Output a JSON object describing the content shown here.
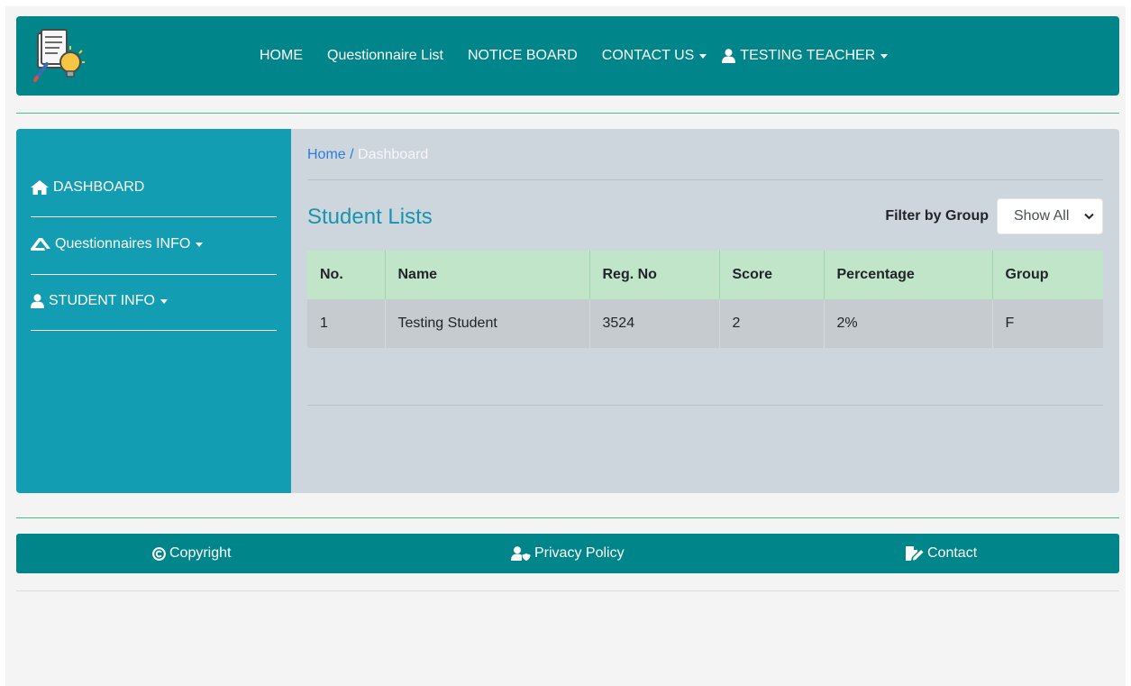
{
  "header": {
    "nav": [
      {
        "label": "HOME"
      },
      {
        "label": "Questionnaire List"
      },
      {
        "label": "NOTICE BOARD"
      },
      {
        "label": "CONTACT US"
      },
      {
        "label": "TESTING TEACHER"
      }
    ],
    "accent_color": "#00868a"
  },
  "sidebar": {
    "items": [
      {
        "label": "DASHBOARD",
        "icon": "home-icon"
      },
      {
        "label": "Questionnaires INFO",
        "icon": "questionnaire-icon"
      },
      {
        "label": "STUDENT INFO",
        "icon": "user-icon"
      }
    ],
    "color": "#139db2"
  },
  "breadcrumb": {
    "home": "Home",
    "separator": "/",
    "current": "Dashboard"
  },
  "main": {
    "title": "Student Lists",
    "filter_label": "Filter by Group",
    "filter_value": "Show All"
  },
  "table": {
    "headers": [
      "No.",
      "Name",
      "Reg. No",
      "Score",
      "Percentage",
      "Group"
    ],
    "rows": [
      [
        "1",
        "Testing Student",
        "3524",
        "2",
        "2%",
        "F"
      ]
    ]
  },
  "footer": {
    "items": [
      {
        "label": "Copyright",
        "icon": "copyright-icon"
      },
      {
        "label": "Privacy Policy",
        "icon": "user-shield-icon"
      },
      {
        "label": "Contact",
        "icon": "edit-icon"
      }
    ]
  }
}
